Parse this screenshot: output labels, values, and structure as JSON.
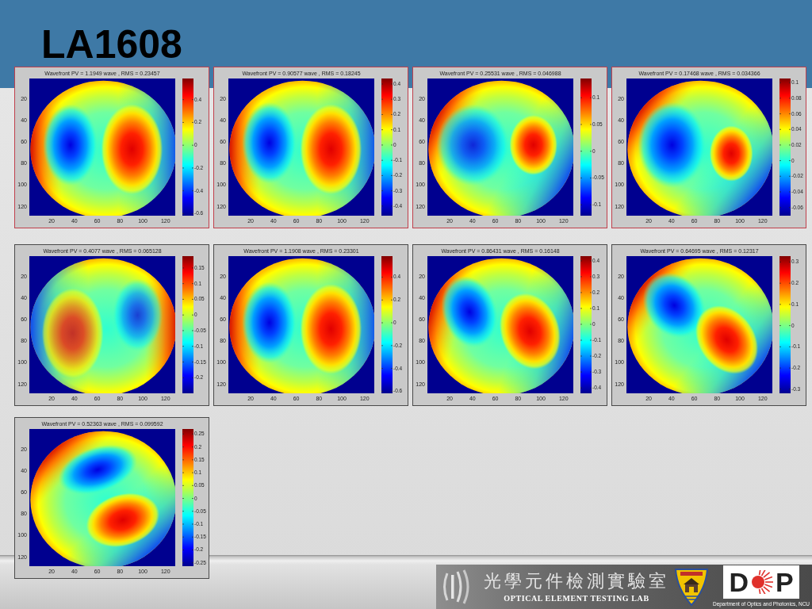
{
  "slide": {
    "title": "LA1608"
  },
  "plots": [
    {
      "title": "Wavefront PV = 1.1949 wave , RMS = 0.23457",
      "color": "#c0404c",
      "y_ticks": [
        "20",
        "40",
        "60",
        "80",
        "100",
        "120"
      ],
      "x_ticks": [
        "20",
        "40",
        "60",
        "80",
        "100",
        "120"
      ],
      "colorbar_ticks": [
        "0.4",
        "0.2",
        "0",
        "-0.2",
        "-0.4",
        "-0.6"
      ]
    },
    {
      "title": "Wavefront PV = 0.90577 wave , RMS = 0.18245",
      "color": "#c0404c",
      "y_ticks": [
        "20",
        "40",
        "60",
        "80",
        "100",
        "120"
      ],
      "x_ticks": [
        "20",
        "40",
        "60",
        "80",
        "100",
        "120"
      ],
      "colorbar_ticks": [
        "0.4",
        "0.3",
        "0.2",
        "0.1",
        "0",
        "-0.1",
        "-0.2",
        "-0.3",
        "-0.4"
      ]
    },
    {
      "title": "Wavefront PV = 0.25531 wave , RMS = 0.046988",
      "color": "#c0404c",
      "y_ticks": [
        "20",
        "40",
        "60",
        "80",
        "100",
        "120"
      ],
      "x_ticks": [
        "20",
        "40",
        "60",
        "80",
        "100",
        "120"
      ],
      "colorbar_ticks": [
        "0.1",
        "0.05",
        "0",
        "-0.05",
        "-0.1"
      ]
    },
    {
      "title": "Wavefront PV = 0.17468 wave , RMS = 0.034366",
      "color": "#c0404c",
      "y_ticks": [
        "20",
        "40",
        "60",
        "80",
        "100",
        "120"
      ],
      "x_ticks": [
        "20",
        "40",
        "60",
        "80",
        "100",
        "120"
      ],
      "colorbar_ticks": [
        "0.1",
        "0.08",
        "0.06",
        "0.04",
        "0.02",
        "0",
        "-0.02",
        "-0.04",
        "-0.06"
      ]
    },
    {
      "title": "Wavefront PV = 0.4077 wave , RMS = 0.065128",
      "color": "#4a4a4a",
      "y_ticks": [
        "20",
        "40",
        "60",
        "80",
        "100",
        "120"
      ],
      "x_ticks": [
        "20",
        "40",
        "60",
        "80",
        "100",
        "120"
      ],
      "colorbar_ticks": [
        "0.15",
        "0.1",
        "0.05",
        "0",
        "-0.05",
        "-0.1",
        "-0.15",
        "-0.2"
      ]
    },
    {
      "title": "Wavefront PV = 1.1908 wave , RMS = 0.23301",
      "color": "#4a4a4a",
      "y_ticks": [
        "20",
        "40",
        "60",
        "80",
        "100",
        "120"
      ],
      "x_ticks": [
        "20",
        "40",
        "60",
        "80",
        "100",
        "120"
      ],
      "colorbar_ticks": [
        "0.4",
        "0.2",
        "0",
        "-0.2",
        "-0.4",
        "-0.6"
      ]
    },
    {
      "title": "Wavefront PV = 0.86431 wave , RMS = 0.16148",
      "color": "#4a4a4a",
      "y_ticks": [
        "20",
        "40",
        "60",
        "80",
        "100",
        "120"
      ],
      "x_ticks": [
        "20",
        "40",
        "60",
        "80",
        "100",
        "120"
      ],
      "colorbar_ticks": [
        "0.4",
        "0.3",
        "0.2",
        "0.1",
        "0",
        "-0.1",
        "-0.2",
        "-0.3",
        "-0.4"
      ]
    },
    {
      "title": "Wavefront PV = 0.64695 wave , RMS = 0.12317",
      "color": "#4a4a4a",
      "y_ticks": [
        "20",
        "40",
        "60",
        "80",
        "100",
        "120"
      ],
      "x_ticks": [
        "20",
        "40",
        "60",
        "80",
        "100",
        "120"
      ],
      "colorbar_ticks": [
        "0.3",
        "0.2",
        "0.1",
        "0",
        "-0.1",
        "-0.2",
        "-0.3"
      ]
    },
    {
      "title": "Wavefront PV = 0.52363 wave , RMS = 0.099592",
      "color": "#4a4a4a",
      "y_ticks": [
        "20",
        "40",
        "60",
        "80",
        "100",
        "120"
      ],
      "x_ticks": [
        "20",
        "40",
        "60",
        "80",
        "100",
        "120"
      ],
      "colorbar_ticks": [
        "0.25",
        "0.2",
        "0.15",
        "0.1",
        "0.05",
        "0",
        "-0.05",
        "-0.1",
        "-0.15",
        "-0.2",
        "-0.25"
      ]
    }
  ],
  "footer": {
    "lab_name": "光學元件檢測實驗室",
    "lab_name_english": "OPTICAL ELEMENT TESTING LAB",
    "logo": {
      "left_letter": "D",
      "right_letter": "P",
      "department": "Department of Optics and Photonics, NCU"
    }
  }
}
